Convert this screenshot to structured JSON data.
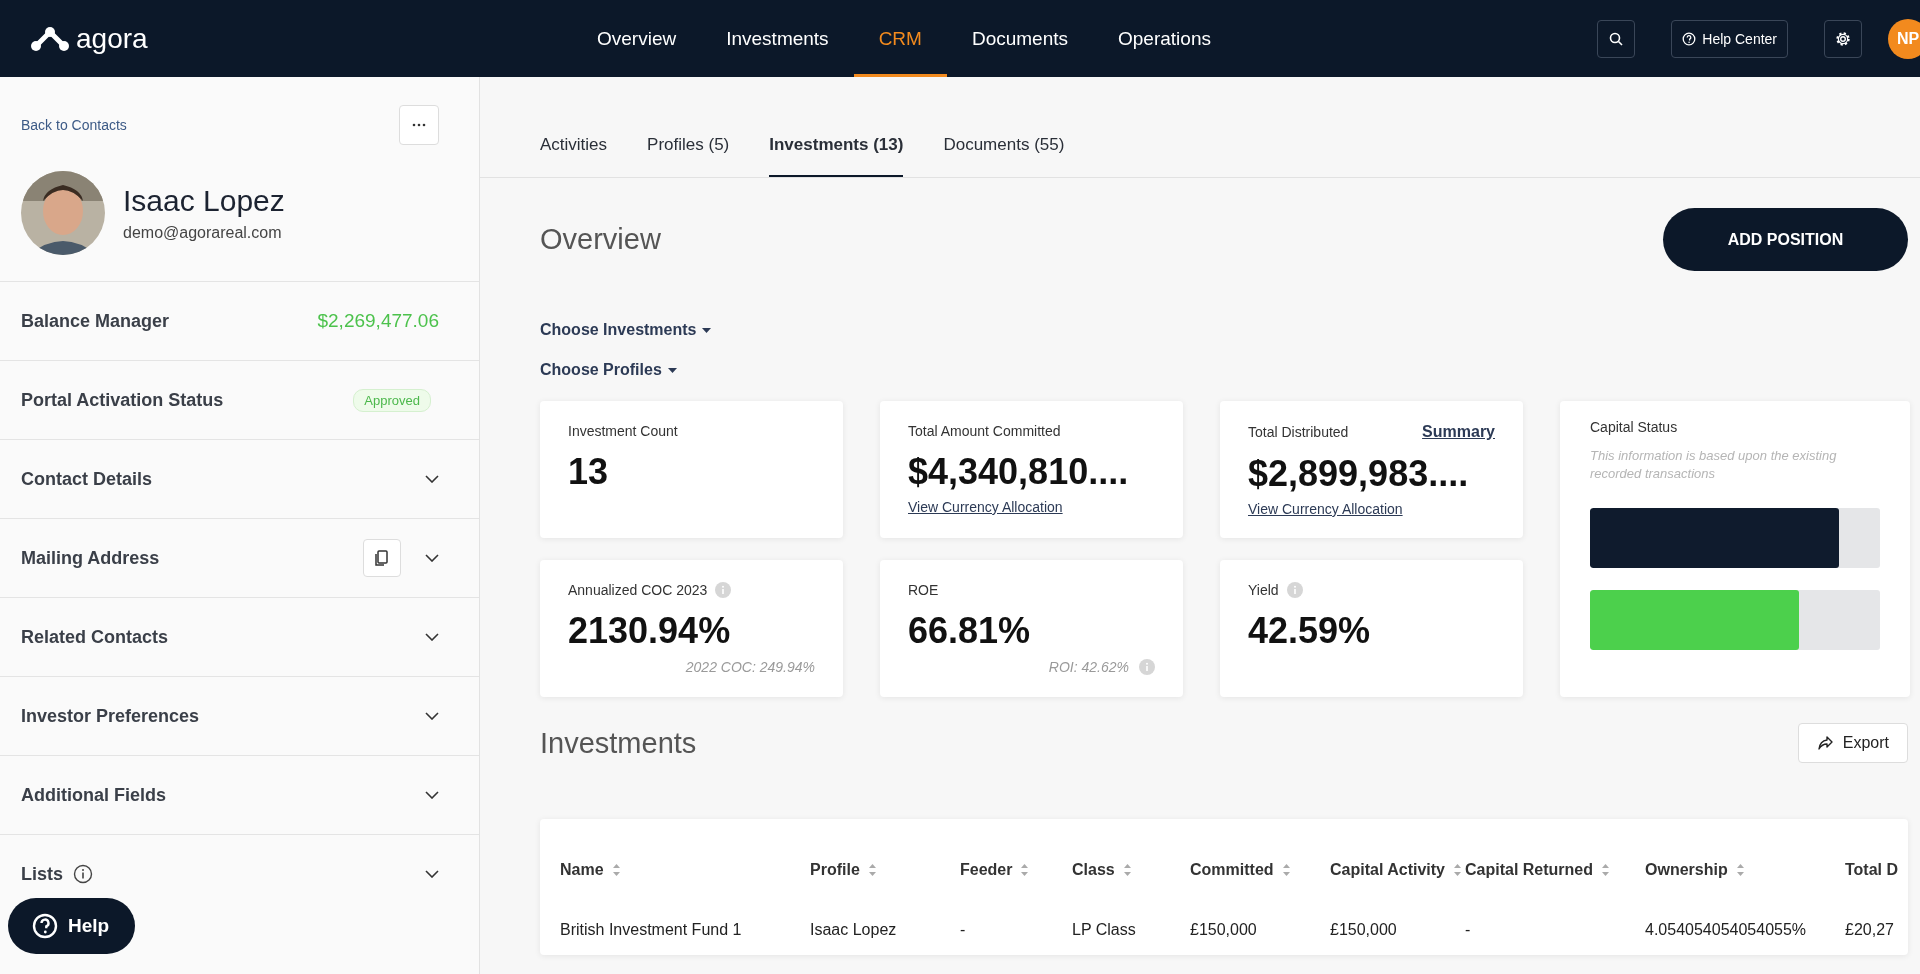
{
  "nav": {
    "logo": "agora",
    "items": [
      {
        "label": "Overview",
        "selected": false
      },
      {
        "label": "Investments",
        "selected": false
      },
      {
        "label": "CRM",
        "selected": true
      },
      {
        "label": "Documents",
        "selected": false
      },
      {
        "label": "Operations",
        "selected": false
      }
    ],
    "help_center": "Help Center",
    "avatar": "NP"
  },
  "sidebar": {
    "back_link": "Back to Contacts",
    "contact": {
      "name": "Isaac Lopez",
      "email": "demo@agorareal.com"
    },
    "rows": [
      {
        "kind": "value",
        "label": "Balance Manager",
        "value": "$2,269,477.06"
      },
      {
        "kind": "badge",
        "label": "Portal Activation Status",
        "value": "Approved"
      },
      {
        "kind": "section",
        "label": "Contact Details",
        "expanded": false
      },
      {
        "kind": "section",
        "label": "Mailing Address",
        "expanded": false,
        "copy": true
      },
      {
        "kind": "section",
        "label": "Related Contacts",
        "expanded": false
      },
      {
        "kind": "section",
        "label": "Investor Preferences",
        "expanded": false
      },
      {
        "kind": "section",
        "label": "Additional Fields",
        "expanded": false
      },
      {
        "kind": "section",
        "label": "Lists",
        "expanded": false,
        "info": true
      }
    ],
    "help_button": "Help"
  },
  "tabs": [
    {
      "label": "Activities",
      "selected": false
    },
    {
      "label": "Profiles (5)",
      "selected": false
    },
    {
      "label": "Investments (13)",
      "selected": true
    },
    {
      "label": "Documents (55)",
      "selected": false
    }
  ],
  "overview": {
    "title": "Overview",
    "add_button": "ADD POSITION",
    "filters": [
      "Choose Investments",
      "Choose Profiles"
    ],
    "cards": [
      {
        "label": "Investment Count",
        "value": "13"
      },
      {
        "label": "Total Amount Committed",
        "value": "$4,340,810....",
        "link": "View Currency Allocation"
      },
      {
        "label": "Total Distributed",
        "value": "$2,899,983....",
        "link": "View Currency Allocation",
        "action": "Summary"
      },
      {
        "label": "Annualized COC 2023",
        "value": "2130.94%",
        "info": true,
        "note": "2022 COC: 249.94%"
      },
      {
        "label": "ROE",
        "value": "66.81%",
        "note": "ROI: 42.62%",
        "note_info": true
      },
      {
        "label": "Yield",
        "value": "42.59%",
        "info": true
      }
    ],
    "capital_status": {
      "title": "Capital Status",
      "note": "This information is based upon the existing recorded transactions",
      "bars": [
        {
          "color": "#0f1b2d",
          "level": 0.86
        },
        {
          "color": "#4cd04c",
          "level": 0.72
        }
      ]
    }
  },
  "investments": {
    "title": "Investments",
    "export_button": "Export",
    "columns": [
      "Name",
      "Profile",
      "Feeder",
      "Class",
      "Committed",
      "Capital Activity",
      "Capital Returned",
      "Ownership",
      "Total D"
    ],
    "rows": [
      [
        "British Investment Fund 1",
        "Isaac Lopez",
        "-",
        "LP Class",
        "£150,000",
        "£150,000",
        "-",
        "4.054054054054055%",
        "£20,27"
      ]
    ]
  }
}
